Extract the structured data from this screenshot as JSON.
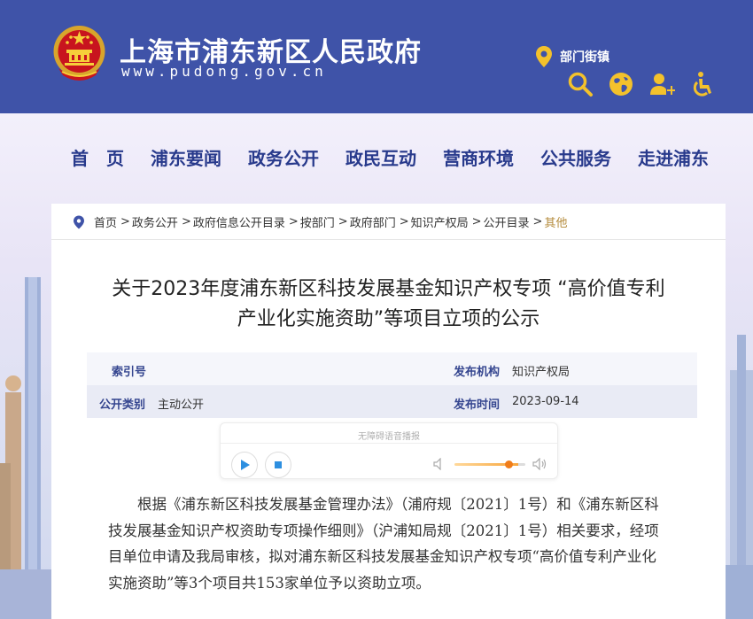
{
  "header": {
    "site_title": "上海市浦东新区人民政府",
    "site_url": "www.pudong.gov.cn",
    "dept_link": "部门街镇",
    "icons": [
      "location-pin-icon",
      "search-icon",
      "globe-icon",
      "user-icon",
      "accessibility-icon"
    ],
    "brand_color": "#3f53a8"
  },
  "nav": {
    "items": [
      "首　页",
      "浦东要闻",
      "政务公开",
      "政民互动",
      "营商环境",
      "公共服务",
      "走进浦东"
    ]
  },
  "breadcrumb": {
    "items": [
      "首页",
      "政务公开",
      "政府信息公开目录",
      "按部门",
      "政府部门",
      "知识产权局",
      "公开目录",
      "其他"
    ],
    "separator": ">"
  },
  "article": {
    "title_line1": "关于2023年度浦东新区科技发展基金知识产权专项 “高价值专利",
    "title_line2": "产业化实施资助”等项目立项的公示"
  },
  "meta": {
    "index_label": "索引号",
    "index_value": "",
    "agency_label": "发布机构",
    "agency_value": "知识产权局",
    "category_label": "公开类别",
    "category_value": "主动公开",
    "date_label": "发布时间",
    "date_value": "2023-09-14"
  },
  "player": {
    "label": "无障碍语音播报",
    "volume": 0.8
  },
  "body": {
    "paragraph": "根据《浦东新区科技发展基金管理办法》（浦府规〔2021〕1号）和《浦东新区科技发展基金知识产权资助专项操作细则》（沪浦知局规〔2021〕1号）相关要求，经项目单位申请及我局审核，拟对浦东新区科技发展基金知识产权专项“高价值专利产业化实施资助”等3个项目共153家单位予以资助立项。"
  }
}
